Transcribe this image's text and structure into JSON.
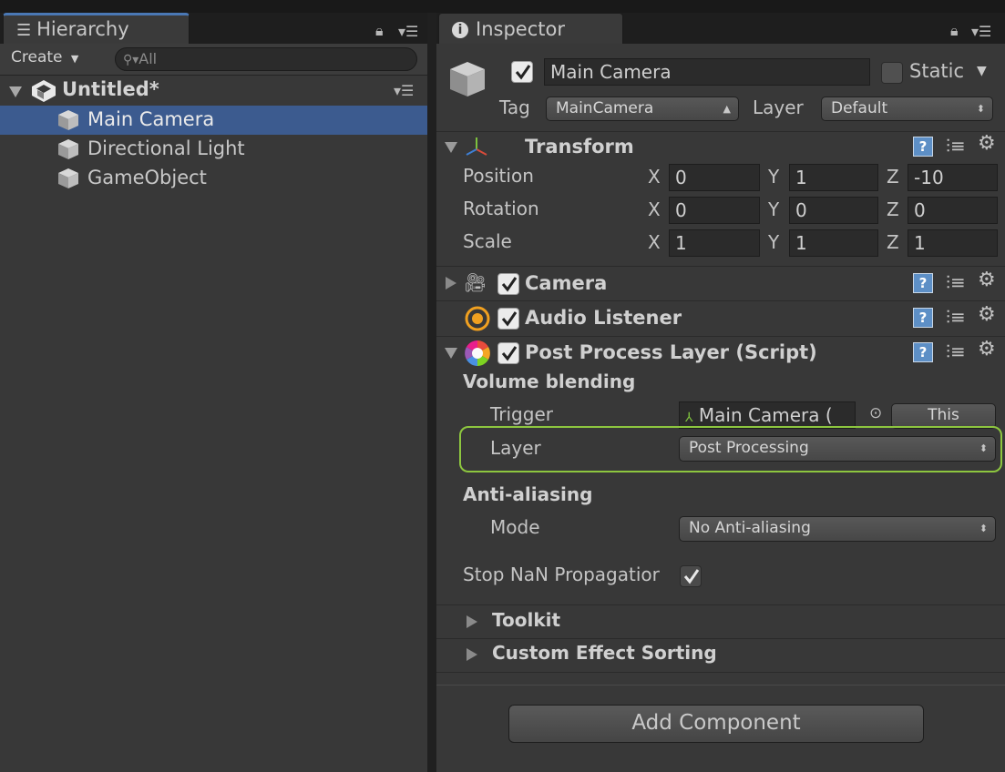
{
  "hierarchy": {
    "tab_label": "Hierarchy",
    "create_label": "Create",
    "search_placeholder": "All",
    "scene_name": "Untitled*",
    "items": [
      {
        "label": "Main Camera"
      },
      {
        "label": "Directional Light"
      },
      {
        "label": "GameObject"
      }
    ]
  },
  "inspector": {
    "tab_label": "Inspector",
    "object_name": "Main Camera",
    "static_label": "Static",
    "tag_label": "Tag",
    "tag_value": "MainCamera",
    "layer_label": "Layer",
    "layer_value": "Default",
    "transform": {
      "title": "Transform",
      "rows": [
        {
          "label": "Position",
          "x": "0",
          "y": "1",
          "z": "-10"
        },
        {
          "label": "Rotation",
          "x": "0",
          "y": "0",
          "z": "0"
        },
        {
          "label": "Scale",
          "x": "1",
          "y": "1",
          "z": "1"
        }
      ],
      "axis_x": "X",
      "axis_y": "Y",
      "axis_z": "Z"
    },
    "camera_title": "Camera",
    "audio_title": "Audio Listener",
    "ppl": {
      "title": "Post Process Layer (Script)",
      "volume_blending": "Volume blending",
      "trigger_label": "Trigger",
      "trigger_value": "Main Camera (",
      "this_button": "This",
      "layer_label": "Layer",
      "layer_value": "Post Processing",
      "anti_aliasing": "Anti-aliasing",
      "mode_label": "Mode",
      "mode_value": "No Anti-aliasing",
      "stop_nan_label": "Stop NaN Propagatior",
      "toolkit": "Toolkit",
      "custom_sorting": "Custom Effect Sorting"
    },
    "add_component": "Add Component"
  },
  "colors": {
    "selection": "#3c5b8f",
    "highlight_outline": "#8dc63f",
    "panel": "#383838"
  }
}
